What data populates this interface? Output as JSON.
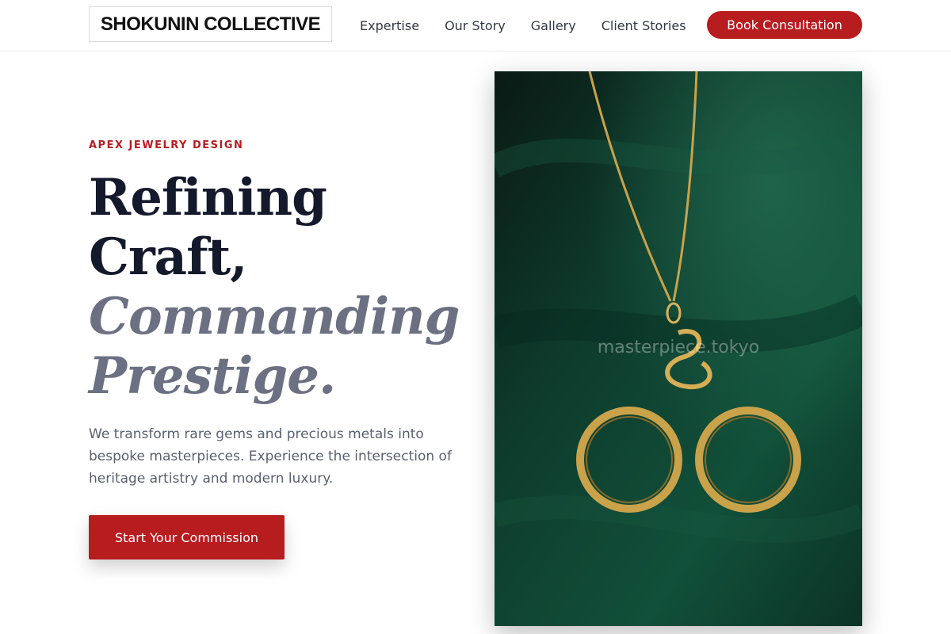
{
  "header": {
    "logo": "SHOKUNIN COLLECTIVE",
    "nav": [
      "Expertise",
      "Our Story",
      "Gallery",
      "Client Stories"
    ],
    "cta_label": "Book Consultation"
  },
  "hero": {
    "eyebrow": "APEX JEWELRY DESIGN",
    "headline_line1": "Refining",
    "headline_line2": "Craft,",
    "headline_line3": "Commanding",
    "headline_line4": "Prestige.",
    "lead": "We transform rare gems and precious metals into bespoke masterpieces. Experience the intersection of heritage artistry and modern luxury.",
    "cta_label": "Start Your Commission",
    "image_watermark": "masterpiece.tokyo"
  },
  "colors": {
    "accent": "#b71c1f",
    "heading": "#141a2b",
    "heading_italic": "#6b7182",
    "image_bg": "#0f3a2a",
    "gold": "#c9a24a"
  }
}
